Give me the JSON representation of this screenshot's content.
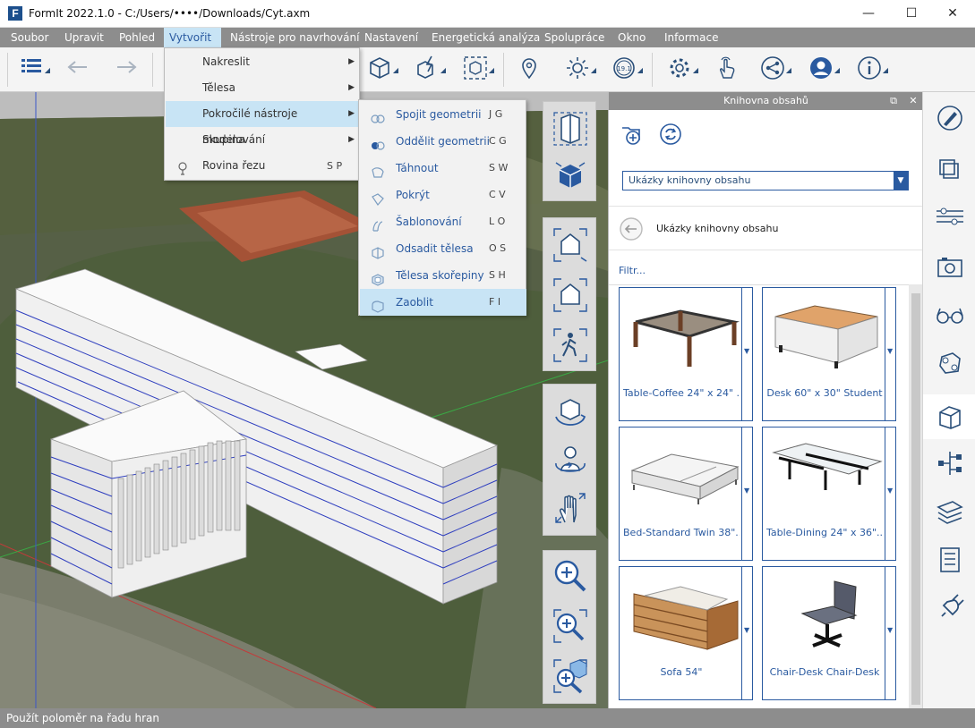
{
  "window": {
    "title": "FormIt 2022.1.0 - C:/Users/••••/Downloads/Cyt.axm",
    "minimize_glyph": "—",
    "maximize_glyph": "☐",
    "close_glyph": "✕"
  },
  "menu": [
    "Soubor",
    "Upravit",
    "Pohled",
    "Vytvořit",
    "Nástroje pro navrhování",
    "Nastavení",
    "Energetická analýza",
    "Spolupráce",
    "Okno",
    "Informace"
  ],
  "toolbar_icons": [
    "layers-icon",
    "undo-icon",
    "redo-icon",
    "box-add-icon",
    "lightning-box-icon",
    "box-select-icon",
    "location-pin-icon",
    "sun-icon",
    "scale-icon",
    "gear-icon",
    "hand-touch-icon",
    "share-icon",
    "user-icon",
    "info-icon"
  ],
  "create_menu": [
    {
      "label": "Nakreslit",
      "arrow": "▶"
    },
    {
      "label": "Tělesa",
      "arrow": "▶"
    },
    {
      "label": "Pokročilé nástroje modelování",
      "arrow": "▶"
    },
    {
      "label": "Skupina",
      "arrow": "▶"
    },
    {
      "label": "Rovina řezu",
      "shortcut": "S P"
    }
  ],
  "advanced_menu": [
    {
      "label": "Spojit geometrii",
      "shortcut": "J G"
    },
    {
      "label": "Oddělit geometrii",
      "shortcut": "C G"
    },
    {
      "label": "Táhnout",
      "shortcut": "S W"
    },
    {
      "label": "Pokrýt",
      "shortcut": "C V"
    },
    {
      "label": "Šablonování",
      "shortcut": "L O"
    },
    {
      "label": "Odsadit tělesa",
      "shortcut": "O S"
    },
    {
      "label": "Tělesa skořepiny",
      "shortcut": "S H"
    },
    {
      "label": "Zaoblit",
      "shortcut": "F I"
    }
  ],
  "library": {
    "title": "Knihovna obsahů",
    "dock_glyph": "⧉",
    "close_glyph": "✕",
    "select_value": "Ukázky knihovny obsahu",
    "select_arrow": "▼",
    "path_label": "Ukázky knihovny obsahu",
    "filter_placeholder": "Filtr...",
    "items": [
      "Table-Coffee 24\" x 24\" ...",
      "Desk 60\" x 30\" Student",
      "Bed-Standard Twin 38\"...",
      "Table-Dining 24\" x 36\"...",
      "Sofa 54\"",
      "Chair-Desk Chair-Desk"
    ],
    "card_arrow": "▼"
  },
  "side_panel_icons": [
    "properties-icon",
    "materials-icon",
    "levels-icon",
    "scenes-icon",
    "visual-styles-icon",
    "groups-icon",
    "content-library-icon",
    "dynamo-icon",
    "layers-panel-icon",
    "parameters-icon",
    "plugins-icon"
  ],
  "status": "Použít poloměr na řadu hran",
  "colors": {
    "menubar": "#8d8d8d",
    "accent": "#2a5aa0",
    "highlight": "#c8e4f5"
  }
}
